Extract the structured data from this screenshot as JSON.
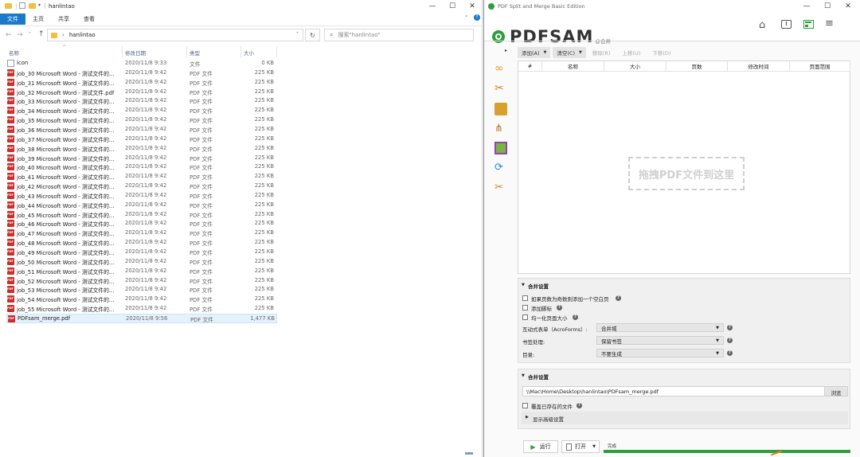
{
  "explorer": {
    "title": "hanlintao",
    "ribbon_tabs": [
      "文件",
      "主页",
      "共享",
      "查看"
    ],
    "breadcrumb": "hanlintao",
    "search_placeholder": "搜索\"hanlintao\"",
    "columns": {
      "name": "名称",
      "date": "修改日期",
      "type": "类型",
      "size": "大小"
    },
    "files": [
      {
        "name": "Icon",
        "date": "2020/11/8 9:33",
        "type": "文件",
        "size": "0 KB",
        "icon": "file"
      },
      {
        "name": "job_30 Microsoft Word - 测试文件的...",
        "date": "2020/11/8 9:42",
        "type": "PDF 文件",
        "size": "225 KB",
        "icon": "pdf"
      },
      {
        "name": "job_31 Microsoft Word - 测试文件的...",
        "date": "2020/11/8 9:42",
        "type": "PDF 文件",
        "size": "225 KB",
        "icon": "pdf"
      },
      {
        "name": "job_32 Microsoft Word - 测试文件.pdf",
        "date": "2020/11/8 9:42",
        "type": "PDF 文件",
        "size": "225 KB",
        "icon": "pdf"
      },
      {
        "name": "job_33 Microsoft Word - 测试文件的...",
        "date": "2020/11/8 9:42",
        "type": "PDF 文件",
        "size": "225 KB",
        "icon": "pdf"
      },
      {
        "name": "job_34 Microsoft Word - 测试文件的...",
        "date": "2020/11/8 9:42",
        "type": "PDF 文件",
        "size": "225 KB",
        "icon": "pdf"
      },
      {
        "name": "job_35 Microsoft Word - 测试文件的...",
        "date": "2020/11/8 9:42",
        "type": "PDF 文件",
        "size": "225 KB",
        "icon": "pdf"
      },
      {
        "name": "job_36 Microsoft Word - 测试文件的...",
        "date": "2020/11/8 9:42",
        "type": "PDF 文件",
        "size": "225 KB",
        "icon": "pdf"
      },
      {
        "name": "job_37 Microsoft Word - 测试文件的...",
        "date": "2020/11/8 9:42",
        "type": "PDF 文件",
        "size": "225 KB",
        "icon": "pdf"
      },
      {
        "name": "job_38 Microsoft Word - 测试文件的...",
        "date": "2020/11/8 9:42",
        "type": "PDF 文件",
        "size": "225 KB",
        "icon": "pdf"
      },
      {
        "name": "job_39 Microsoft Word - 测试文件的...",
        "date": "2020/11/8 9:42",
        "type": "PDF 文件",
        "size": "225 KB",
        "icon": "pdf"
      },
      {
        "name": "job_40 Microsoft Word - 测试文件的...",
        "date": "2020/11/8 9:42",
        "type": "PDF 文件",
        "size": "225 KB",
        "icon": "pdf"
      },
      {
        "name": "job_41 Microsoft Word - 测试文件的...",
        "date": "2020/11/8 9:42",
        "type": "PDF 文件",
        "size": "225 KB",
        "icon": "pdf"
      },
      {
        "name": "job_42 Microsoft Word - 测试文件的...",
        "date": "2020/11/8 9:42",
        "type": "PDF 文件",
        "size": "225 KB",
        "icon": "pdf"
      },
      {
        "name": "job_43 Microsoft Word - 测试文件的...",
        "date": "2020/11/8 9:42",
        "type": "PDF 文件",
        "size": "225 KB",
        "icon": "pdf"
      },
      {
        "name": "job_44 Microsoft Word - 测试文件的...",
        "date": "2020/11/8 9:42",
        "type": "PDF 文件",
        "size": "225 KB",
        "icon": "pdf"
      },
      {
        "name": "job_45 Microsoft Word - 测试文件的...",
        "date": "2020/11/8 9:42",
        "type": "PDF 文件",
        "size": "225 KB",
        "icon": "pdf"
      },
      {
        "name": "job_46 Microsoft Word - 测试文件的...",
        "date": "2020/11/8 9:42",
        "type": "PDF 文件",
        "size": "225 KB",
        "icon": "pdf"
      },
      {
        "name": "job_47 Microsoft Word - 测试文件的...",
        "date": "2020/11/8 9:42",
        "type": "PDF 文件",
        "size": "225 KB",
        "icon": "pdf"
      },
      {
        "name": "job_48 Microsoft Word - 测试文件的...",
        "date": "2020/11/8 9:42",
        "type": "PDF 文件",
        "size": "225 KB",
        "icon": "pdf"
      },
      {
        "name": "job_49 Microsoft Word - 测试文件的...",
        "date": "2020/11/8 9:42",
        "type": "PDF 文件",
        "size": "225 KB",
        "icon": "pdf"
      },
      {
        "name": "job_50 Microsoft Word - 测试文件的...",
        "date": "2020/11/8 9:42",
        "type": "PDF 文件",
        "size": "225 KB",
        "icon": "pdf"
      },
      {
        "name": "job_51 Microsoft Word - 测试文件的...",
        "date": "2020/11/8 9:42",
        "type": "PDF 文件",
        "size": "225 KB",
        "icon": "pdf"
      },
      {
        "name": "job_52 Microsoft Word - 测试文件的...",
        "date": "2020/11/8 9:42",
        "type": "PDF 文件",
        "size": "225 KB",
        "icon": "pdf"
      },
      {
        "name": "job_53 Microsoft Word - 测试文件的...",
        "date": "2020/11/8 9:42",
        "type": "PDF 文件",
        "size": "225 KB",
        "icon": "pdf"
      },
      {
        "name": "job_54 Microsoft Word - 测试文件的...",
        "date": "2020/11/8 9:42",
        "type": "PDF 文件",
        "size": "225 KB",
        "icon": "pdf"
      },
      {
        "name": "job_55 Microsoft Word - 测试文件的...",
        "date": "2020/11/8 9:42",
        "type": "PDF 文件",
        "size": "225 KB",
        "icon": "pdf"
      },
      {
        "name": "PDFsam_merge.pdf",
        "date": "2020/11/8 9:56",
        "type": "PDF 文件",
        "size": "1,477 KB",
        "icon": "pdf",
        "selected": true
      }
    ]
  },
  "pdfsam": {
    "window_title": "PDF Split and Merge Basic Edition",
    "logo_text": "PDFSAM",
    "logo_sub": "@合并",
    "toolbar": {
      "add": "添加(A)",
      "clear": "清空(C)",
      "remove": "移除(R)",
      "up": "上移(U)",
      "down": "下移(D)"
    },
    "table_headers": [
      "#",
      "名称",
      "大小",
      "页数",
      "修改时间",
      "页面范围"
    ],
    "drop_text": "拖拽PDF文件到这里",
    "merge_settings": {
      "title": "合并设置",
      "opt_blank": "如果页数为奇数则添加一个空白页",
      "opt_footer": "添加脚标",
      "opt_normalize": "均一化页面大小",
      "acroforms_label": "互动式表单（AcroForms）:",
      "acroforms_value": "合并域",
      "bookmarks_label": "书签处理:",
      "bookmarks_value": "保留书签",
      "toc_label": "目录:",
      "toc_value": "不要生成"
    },
    "output_settings": {
      "title": "合并设置",
      "path": "\\\\Mac\\Home\\Desktop\\hanlintao\\PDFsam_merge.pdf",
      "browse": "浏览",
      "overwrite": "覆盖已存在的文件",
      "advanced": "显示高级设置"
    },
    "run": "运行",
    "open": "打开",
    "status": "完成",
    "progress": 1.0,
    "colors": {
      "accent": "#2e9e3e",
      "logo": "#333333"
    }
  }
}
